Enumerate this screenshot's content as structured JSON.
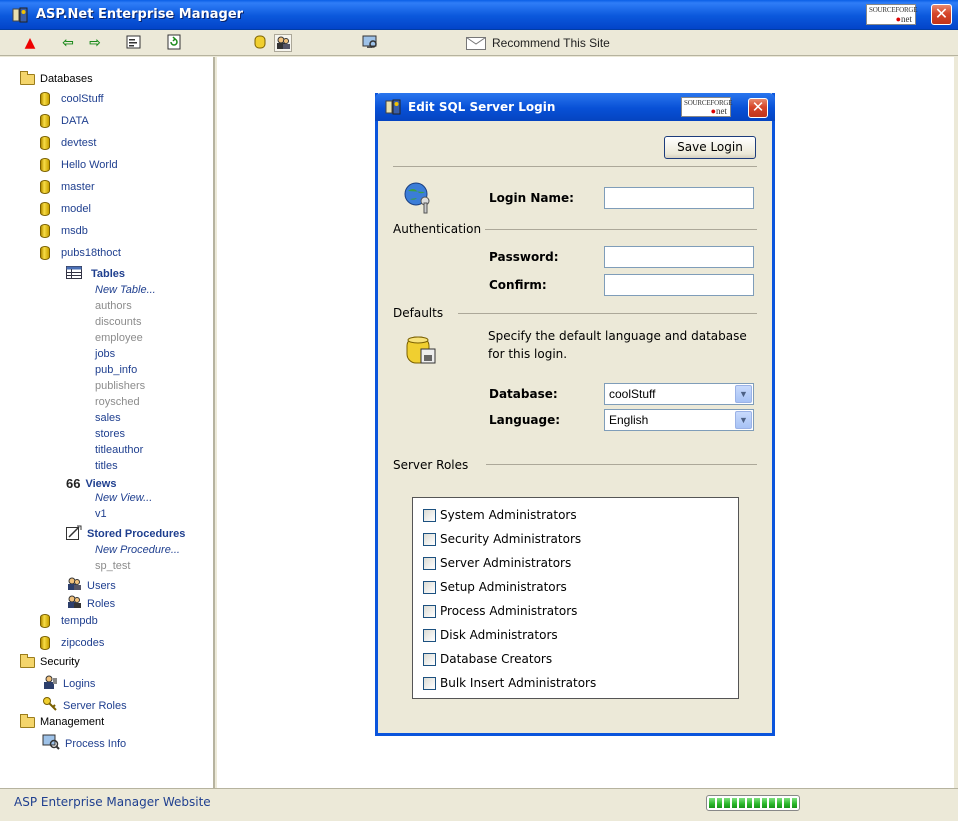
{
  "app": {
    "title": "ASP.Net Enterprise Manager",
    "logo_text": "SOURCEFORGE",
    "logo_suffix": "net"
  },
  "toolbar": {
    "recommend_label": "Recommend This Site"
  },
  "tree": {
    "databases_label": "Databases",
    "databases": [
      "coolStuff",
      "DATA",
      "devtest",
      "Hello World",
      "master",
      "model",
      "msdb",
      "pubs18thoct"
    ],
    "tables_label": "Tables",
    "new_table_label": "New Table...",
    "tables": [
      "authors",
      "discounts",
      "employee",
      "jobs",
      "pub_info",
      "publishers",
      "roysched",
      "sales",
      "stores",
      "titleauthor",
      "titles"
    ],
    "views_label": "Views",
    "new_view_label": "New View...",
    "views": [
      "v1"
    ],
    "procs_label": "Stored Procedures",
    "new_proc_label": "New Procedure...",
    "procs": [
      "sp_test"
    ],
    "users_label": "Users",
    "roles_label": "Roles",
    "more_databases": [
      "tempdb",
      "zipcodes"
    ],
    "security_label": "Security",
    "logins_label": "Logins",
    "server_roles_label": "Server Roles",
    "management_label": "Management",
    "process_info_label": "Process Info"
  },
  "status": {
    "website_link": "ASP Enterprise Manager Website",
    "progress_blocks": 12
  },
  "dialog": {
    "title": "Edit SQL Server Login",
    "save_label": "Save Login",
    "authentication_label": "Authentication",
    "login_name_label": "Login Name:",
    "login_name_value": "",
    "password_label": "Password:",
    "password_value": "",
    "confirm_label": "Confirm:",
    "confirm_value": "",
    "defaults_label": "Defaults",
    "defaults_desc": "Specify the default language and database for this login.",
    "database_label": "Database:",
    "database_value": "coolStuff",
    "language_label": "Language:",
    "language_value": "English",
    "server_roles_label": "Server Roles",
    "roles": [
      {
        "label": "System Administrators",
        "checked": false
      },
      {
        "label": "Security Administrators",
        "checked": false
      },
      {
        "label": "Server Administrators",
        "checked": false
      },
      {
        "label": "Setup Administrators",
        "checked": false
      },
      {
        "label": "Process Administrators",
        "checked": false
      },
      {
        "label": "Disk Administrators",
        "checked": false
      },
      {
        "label": "Database Creators",
        "checked": false
      },
      {
        "label": "Bulk Insert Administrators",
        "checked": false
      }
    ]
  }
}
